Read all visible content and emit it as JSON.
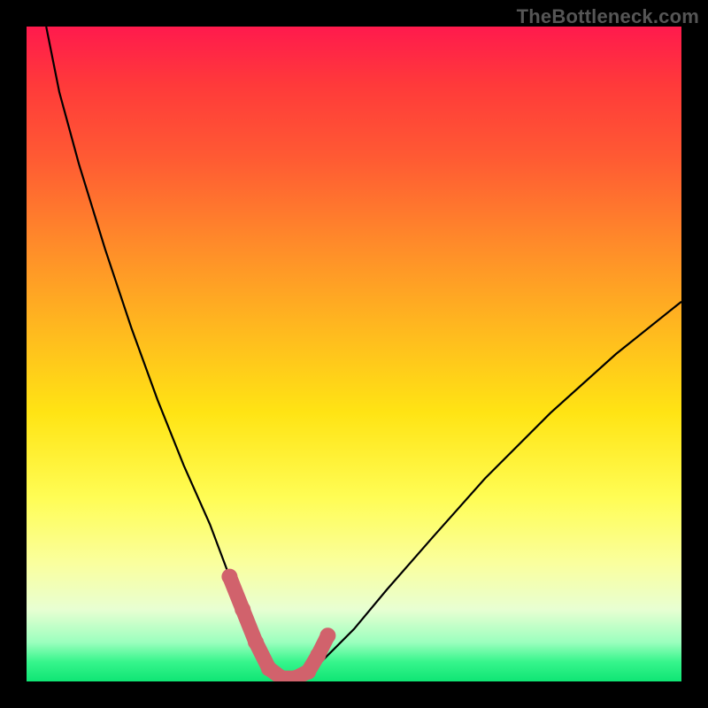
{
  "watermark": "TheBottleneck.com",
  "chart_data": {
    "type": "line",
    "title": "",
    "xlabel": "",
    "ylabel": "",
    "xlim": [
      0,
      100
    ],
    "ylim": [
      0,
      100
    ],
    "series": [
      {
        "name": "bottleneck-curve",
        "x": [
          3,
          5,
          8,
          12,
          16,
          20,
          24,
          28,
          31,
          33,
          35,
          37,
          39,
          41,
          43,
          46,
          50,
          55,
          62,
          70,
          80,
          90,
          100
        ],
        "values": [
          100,
          90,
          79,
          66,
          54,
          43,
          33,
          24,
          16,
          11,
          6,
          2,
          0,
          0,
          1,
          4,
          8,
          14,
          22,
          31,
          41,
          50,
          58
        ]
      }
    ],
    "highlight_zone": {
      "name": "optimal-range",
      "x": [
        31,
        33,
        35,
        37,
        39,
        41,
        43,
        44.5,
        46
      ],
      "values": [
        16,
        11,
        6,
        2,
        0.5,
        0.5,
        1.5,
        4,
        7
      ]
    },
    "colors": {
      "curve": "#000000",
      "highlight": "#d1626c",
      "gradient_top": "#ff1a4d",
      "gradient_mid": "#ffe414",
      "gradient_bottom": "#0fe574",
      "frame": "#000000"
    }
  }
}
